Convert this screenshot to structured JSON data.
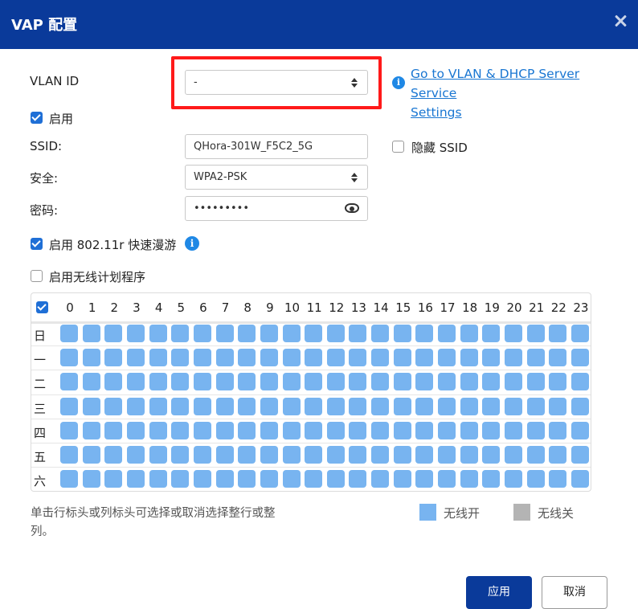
{
  "dialog": {
    "title": "VAP 配置"
  },
  "vlan": {
    "label": "VLAN ID",
    "value": "-",
    "link_line1": "Go to VLAN & DHCP Server Service",
    "link_line2": "Settings"
  },
  "enable": {
    "label": "启用",
    "checked": true
  },
  "ssid": {
    "label": "SSID:",
    "value": "QHora-301W_F5C2_5G",
    "hide_label": "隐藏 SSID",
    "hide_checked": false
  },
  "security": {
    "label": "安全:",
    "value": "WPA2-PSK"
  },
  "password": {
    "label": "密码:",
    "value": "•••••••••"
  },
  "roaming": {
    "label": "启用 802.11r 快速漫游",
    "checked": true
  },
  "schedule": {
    "label": "启用无线计划程序",
    "checked": false,
    "header_checked": true,
    "hours": [
      "0",
      "1",
      "2",
      "3",
      "4",
      "5",
      "6",
      "7",
      "8",
      "9",
      "10",
      "11",
      "12",
      "13",
      "14",
      "15",
      "16",
      "17",
      "18",
      "19",
      "20",
      "21",
      "22",
      "23"
    ],
    "days": [
      "日",
      "一",
      "二",
      "三",
      "四",
      "五",
      "六"
    ],
    "all_on": true
  },
  "hint_line1": "单击行标头或列标头可选择或取消选择整行或整",
  "hint_line2": "列。",
  "legend": {
    "on": {
      "label": "无线开",
      "color": "#78b4f0"
    },
    "off": {
      "label": "无线关",
      "color": "#b4b4b4"
    }
  },
  "buttons": {
    "apply": "应用",
    "cancel": "取消"
  }
}
